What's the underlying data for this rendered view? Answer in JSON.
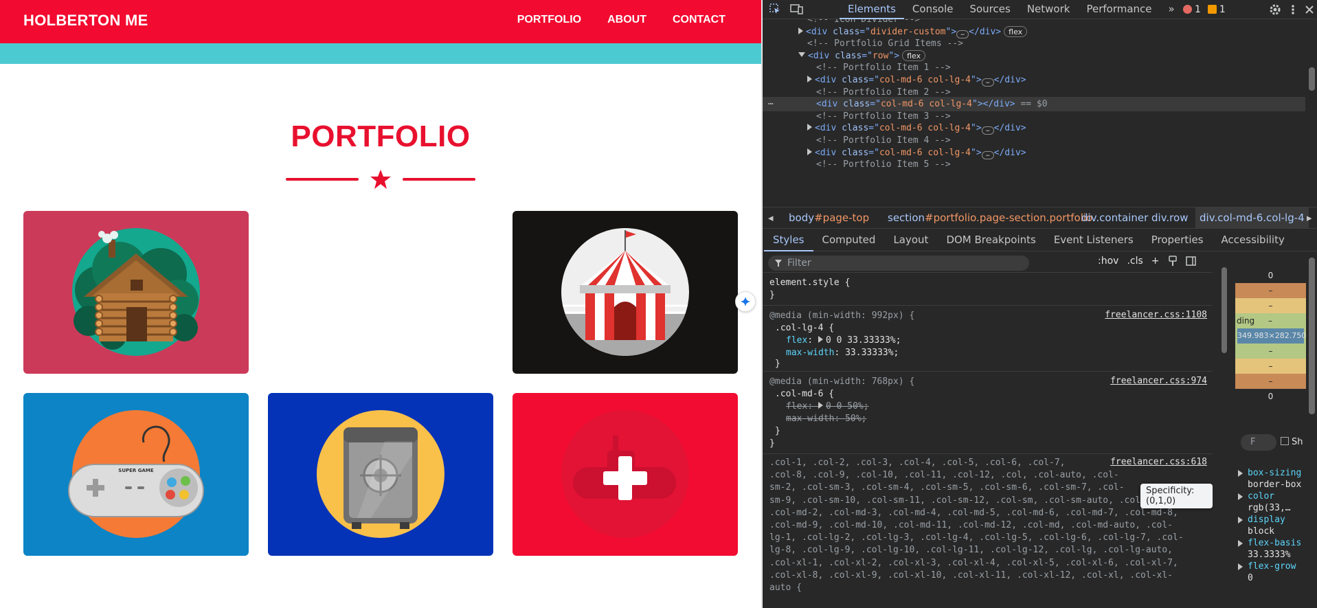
{
  "website": {
    "brand": "HOLBERTON ME",
    "nav": [
      "PORTFOLIO",
      "ABOUT",
      "CONTACT"
    ],
    "section_title": "PORTFOLIO",
    "tiles": [
      {
        "name": "cabin",
        "bg": "#cc3a59"
      },
      {
        "name": "circus-tent",
        "bg": "#161413"
      },
      {
        "name": "game-controller",
        "bg": "#0d84c6"
      },
      {
        "name": "safe",
        "bg": "#0433b8"
      },
      {
        "name": "submarine-add",
        "bg": "#f20c31"
      }
    ],
    "controller_label": "SUPER GAME",
    "colors": {
      "navbar": "#f20a30",
      "band": "#4ccad1",
      "accent": "#e8102e"
    }
  },
  "devtools": {
    "tabs": [
      "Elements",
      "Console",
      "Sources",
      "Network",
      "Performance"
    ],
    "more": "»",
    "errors": "1",
    "warnings": "1",
    "dom_lines": [
      {
        "indent": 5,
        "kind": "comment",
        "text": "<!-- Icon Divider -->"
      },
      {
        "indent": 4,
        "kind": "node",
        "open": false,
        "tag": "div",
        "cls": "divider-custom",
        "badge": "flex"
      },
      {
        "indent": 5,
        "kind": "comment",
        "text": "<!-- Portfolio Grid Items -->"
      },
      {
        "indent": 4,
        "kind": "node",
        "open": true,
        "tag": "div",
        "cls": "row",
        "badge": "flex"
      },
      {
        "indent": 6,
        "kind": "comment",
        "text": "<!-- Portfolio Item 1 -->"
      },
      {
        "indent": 5,
        "kind": "node",
        "open": false,
        "tag": "div",
        "cls": "col-md-6 col-lg-4"
      },
      {
        "indent": 6,
        "kind": "comment",
        "text": "<!-- Portfolio Item 2 -->"
      },
      {
        "indent": 6,
        "kind": "selected",
        "tag": "div",
        "cls": "col-md-6 col-lg-4",
        "suffix": "== $0"
      },
      {
        "indent": 6,
        "kind": "comment",
        "text": "<!-- Portfolio Item 3 -->"
      },
      {
        "indent": 5,
        "kind": "node",
        "open": false,
        "tag": "div",
        "cls": "col-md-6 col-lg-4"
      },
      {
        "indent": 6,
        "kind": "comment",
        "text": "<!-- Portfolio Item 4 -->"
      },
      {
        "indent": 5,
        "kind": "node",
        "open": false,
        "tag": "div",
        "cls": "col-md-6 col-lg-4"
      },
      {
        "indent": 6,
        "kind": "comment",
        "text": "<!-- Portfolio Item 5 -->"
      }
    ],
    "breadcrumbs": [
      {
        "a": "body",
        "b": "#page-top"
      },
      {
        "a": "section",
        "b": "#portfolio.page-section.portfolio"
      },
      {
        "a": "div",
        "b": ".container"
      },
      {
        "a": "div",
        "b": ".row"
      },
      {
        "a": "div",
        "b": ".col-md-6.col-lg-4"
      }
    ],
    "subtabs": [
      "Styles",
      "Computed",
      "Layout",
      "DOM Breakpoints",
      "Event Listeners",
      "Properties",
      "Accessibility"
    ],
    "filter_placeholder": "Filter",
    "filter_buttons": [
      ":hov",
      ".cls"
    ],
    "element_style": "element.style {",
    "rule1": {
      "media": "@media (min-width: 992px) {",
      "selector": ".col-lg-4 {",
      "source": "freelancer.css:1108",
      "props": [
        {
          "p": "flex",
          "v": "0 0 33.33333%;"
        },
        {
          "p": "max-width",
          "v": "33.33333%;"
        }
      ]
    },
    "rule2": {
      "media": "@media (min-width: 768px) {",
      "selector": ".col-md-6 {",
      "source": "freelancer.css:974",
      "props": [
        {
          "p": "flex",
          "v": "0 0 50%;"
        },
        {
          "p": "max-width",
          "v": "50%;"
        }
      ]
    },
    "rule3_source": "freelancer.css:618",
    "rule3_lines": [
      ".col-1, .col-2, .col-3, .col-4, .col-5, .col-6, .col-7,",
      ".col-8, .col-9, .col-10, .col-11, .col-12, .col, .col-auto, .col-",
      "sm-2, .col-sm-3, .col-sm-4, .col-sm-5, .col-sm-6, .col-sm-7, .col-",
      "sm-9, .col-sm-10, .col-sm-11, .col-sm-12, .col-sm, .col-sm-auto, .col-md-1,",
      ".col-md-2, .col-md-3, .col-md-4, .col-md-5, .col-md-6, .col-md-7, .col-md-8,",
      ".col-md-9, .col-md-10, .col-md-11, .col-md-12, .col-md, .col-md-auto, .col-",
      "lg-1, .col-lg-2, .col-lg-3, .col-lg-4, .col-lg-5, .col-lg-6, .col-lg-7, .col-",
      "lg-8, .col-lg-9, .col-lg-10, .col-lg-11, .col-lg-12, .col-lg, .col-lg-auto,",
      ".col-xl-1, .col-xl-2, .col-xl-3, .col-xl-4, .col-xl-5, .col-xl-6, .col-xl-7,",
      ".col-xl-8, .col-xl-9, .col-xl-10, .col-xl-11, .col-xl-12, .col-xl, .col-xl-",
      "auto {"
    ],
    "tooltip": "Specificity: (0,1,0)",
    "box_model": {
      "margin_top": "0",
      "dash": "–",
      "padding_label": "ding",
      "content": "349.983×282.750",
      "margin_bottom": "0"
    },
    "computed_filter": "F",
    "computed_show": "Sh",
    "computed": [
      {
        "p": "box-sizing",
        "v": "border-box"
      },
      {
        "p": "color",
        "v": "rgb(33,…"
      },
      {
        "p": "display",
        "v": "block"
      },
      {
        "p": "flex-basis",
        "v": "33.3333%"
      },
      {
        "p": "flex-grow",
        "v": "0"
      }
    ]
  }
}
